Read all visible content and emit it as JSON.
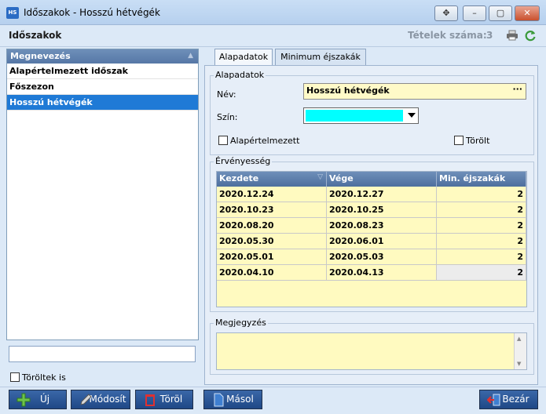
{
  "window": {
    "app_icon_text": "HS",
    "title": "Időszakok - Hosszú hétvégék",
    "controls": {
      "move": "✥",
      "minimize": "–",
      "maximize": "▢",
      "close": "✕"
    }
  },
  "header": {
    "title": "Időszakok",
    "count_label": "Tételek száma:",
    "count_value": "3"
  },
  "list": {
    "column_header": "Megnevezés",
    "items": [
      {
        "label": "Alapértelmezett időszak",
        "selected": false
      },
      {
        "label": "Főszezon",
        "selected": false
      },
      {
        "label": "Hosszú hétvégék",
        "selected": true
      }
    ],
    "filter_value": "",
    "show_deleted_label": "Töröltek is",
    "show_deleted_checked": false
  },
  "tabs": [
    {
      "label": "Alapadatok",
      "active": true
    },
    {
      "label": "Minimum éjszakák",
      "active": false
    }
  ],
  "basic": {
    "group_label": "Alapadatok",
    "name_label": "Név:",
    "name_value": "Hosszú hétvégék",
    "color_label": "Szín:",
    "color_value": "#00ffff",
    "default_label": "Alapértelmezett",
    "default_checked": false,
    "deleted_label": "Törölt",
    "deleted_checked": false
  },
  "validity": {
    "group_label": "Érvényesség",
    "columns": [
      "Kezdete",
      "Vége",
      "Min. éjszakák"
    ],
    "rows": [
      [
        "2020.12.24",
        "2020.12.27",
        "2"
      ],
      [
        "2020.10.23",
        "2020.10.25",
        "2"
      ],
      [
        "2020.08.20",
        "2020.08.23",
        "2"
      ],
      [
        "2020.05.30",
        "2020.06.01",
        "2"
      ],
      [
        "2020.05.01",
        "2020.05.03",
        "2"
      ],
      [
        "2020.04.10",
        "2020.04.13",
        "2"
      ]
    ]
  },
  "note": {
    "group_label": "Megjegyzés",
    "value": ""
  },
  "buttons": {
    "new": "Új",
    "edit": "Módosít",
    "delete": "Töröl",
    "copy": "Másol",
    "close": "Bezár"
  },
  "colors": {
    "accent": "#1f7ad6",
    "header_blue": "#5677a6",
    "input_yellow": "#fffac8",
    "button_blue": "#1f4886"
  }
}
